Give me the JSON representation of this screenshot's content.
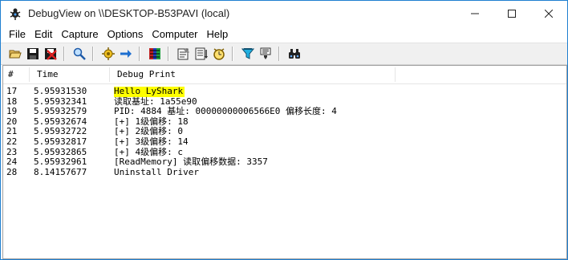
{
  "window": {
    "title": "DebugView on \\\\DESKTOP-B53PAVI (local)"
  },
  "menu": [
    "File",
    "Edit",
    "Capture",
    "Options",
    "Computer",
    "Help"
  ],
  "toolbar": {
    "icons": [
      "open-icon",
      "save-icon",
      "clear-log-icon",
      "find-icon",
      "capture-icon",
      "autoscroll-icon",
      "clear-display-icon",
      "time-format-icon",
      "history-depth-icon",
      "clock-icon",
      "filter-icon",
      "highlight-icon",
      "binoculars-icon"
    ]
  },
  "columns": {
    "num": "#",
    "time": "Time",
    "debug": "Debug Print"
  },
  "rows": [
    {
      "num": "17",
      "time": "5.95931530",
      "msg": "Hello LyShark",
      "highlight": true
    },
    {
      "num": "18",
      "time": "5.95932341",
      "msg": "读取基址: 1a55e90"
    },
    {
      "num": "19",
      "time": "5.95932579",
      "msg": "PID: 4884 基址: 00000000006566E0 偏移长度: 4"
    },
    {
      "num": "20",
      "time": "5.95932674",
      "msg": "[+] 1级偏移: 18"
    },
    {
      "num": "21",
      "time": "5.95932722",
      "msg": "[+] 2级偏移: 0"
    },
    {
      "num": "22",
      "time": "5.95932817",
      "msg": "[+] 3级偏移: 14"
    },
    {
      "num": "23",
      "time": "5.95932865",
      "msg": "[+] 4级偏移: c"
    },
    {
      "num": "24",
      "time": "5.95932961",
      "msg": "[ReadMemory] 读取偏移数据: 3357"
    },
    {
      "num": "28",
      "time": "8.14157677",
      "msg": "Uninstall Driver"
    }
  ],
  "colors": {
    "highlight": "#ffff00",
    "window_border": "#1f7fd0"
  }
}
